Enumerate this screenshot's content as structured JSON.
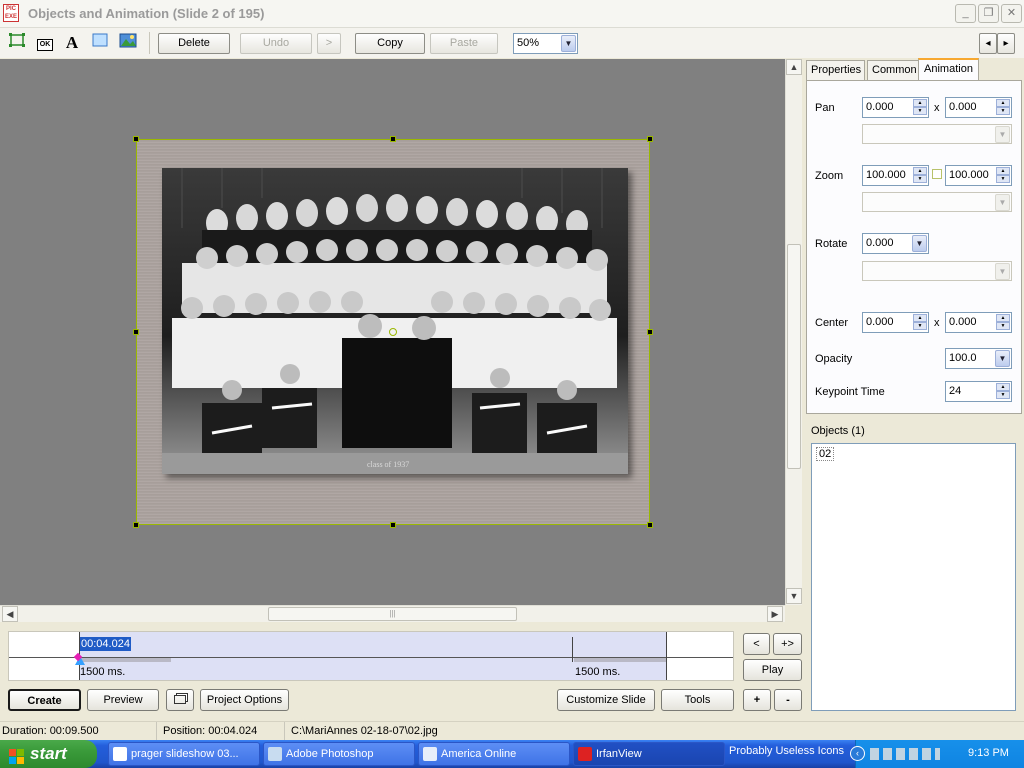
{
  "window": {
    "title": "Objects and Animation  (Slide 2 of 195)",
    "app_icon_text": "PIC\nEXE",
    "minimize": "_",
    "restore": "❐",
    "close": "✕"
  },
  "toolbar": {
    "tool_icons": [
      "rectangle-select-icon",
      "button-icon",
      "text-icon",
      "box-icon",
      "image-icon"
    ],
    "text_tool_glyph": "A",
    "button_tool_label": "OK",
    "delete_label": "Delete",
    "undo_label": "Undo",
    "redo_label": ">",
    "copy_label": "Copy",
    "paste_label": "Paste",
    "zoom_value": "50%",
    "nav_prev": "◂",
    "nav_next": "▸"
  },
  "canvas": {
    "photo_caption": "class of 1937"
  },
  "tabs": [
    {
      "label": "Properties",
      "active": false
    },
    {
      "label": "Common",
      "active": false
    },
    {
      "label": "Animation",
      "active": true
    }
  ],
  "animation": {
    "pan_label": "Pan",
    "pan_x": "0.000",
    "pan_y": "0.000",
    "x_sep": "x",
    "zoom_label": "Zoom",
    "zoom_x": "100.000",
    "zoom_y": "100.000",
    "rotate_label": "Rotate",
    "rotate_value": "0.000",
    "center_label": "Center",
    "center_x": "0.000",
    "center_y": "0.000",
    "opacity_label": "Opacity",
    "opacity_value": "100.0",
    "keypoint_label": "Keypoint Time",
    "keypoint_value": "24"
  },
  "objects": {
    "header": "Objects (1)",
    "items": [
      "02"
    ]
  },
  "timeline": {
    "current_time": "00:04.024",
    "left_duration": "1500 ms.",
    "right_duration": "1500 ms.",
    "prev_label": "<",
    "add_label": "+>",
    "play_label": "Play",
    "plus_label": "+",
    "minus_label": "-"
  },
  "buttons": {
    "create": "Create",
    "preview": "Preview",
    "project_options": "Project Options",
    "customize_slide": "Customize Slide",
    "tools": "Tools"
  },
  "status": {
    "duration": "Duration:  00:09.500",
    "position": "Position:  00:04.024",
    "path": "C:\\MariAnnes 02-18-07\\02.jpg"
  },
  "taskbar": {
    "start_label": "start",
    "items": [
      {
        "label": "prager slideshow 03...",
        "active": false
      },
      {
        "label": "Adobe Photoshop",
        "active": false
      },
      {
        "label": "America  Online",
        "active": false
      },
      {
        "label": "IrfanView",
        "active": true
      },
      {
        "label": "Probably Useless Icons",
        "active": false
      }
    ],
    "clock": "9:13 PM"
  }
}
